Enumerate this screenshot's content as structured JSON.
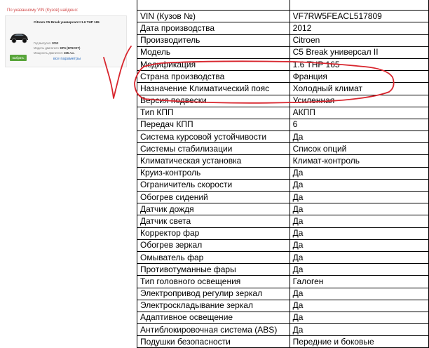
{
  "vin_panel": {
    "found_text": "По указанному VIN (Кузов) найдено:",
    "car_title": "Citroen C5 Break универсал II 1.6 THP 165",
    "specs": [
      {
        "label": "Год выпуска:",
        "value": "2012"
      },
      {
        "label": "Модель двигателя:",
        "value": "EP6 (EP6CDT)"
      },
      {
        "label": "Мощность двигателя:",
        "value": "155 л.с."
      }
    ],
    "select_button": "выбрать",
    "all_params_link": "все параметры"
  },
  "table": {
    "rows": [
      {
        "name": "",
        "value": ""
      },
      {
        "name": "VIN (Кузов №)",
        "value": "VF7RW5FEACL517809"
      },
      {
        "name": "Дата производства",
        "value": "2012"
      },
      {
        "name": "Производитель",
        "value": "Citroen"
      },
      {
        "name": "Модель",
        "value": "C5 Break универсал II"
      },
      {
        "name": "Модификация",
        "value": "1.6 THP 165"
      },
      {
        "name": "Страна производства",
        "value": "Франция"
      },
      {
        "name": "Назначение Климатический пояс",
        "value": "Холодный климат"
      },
      {
        "name": "Версия подвески",
        "value": "Усиленная"
      },
      {
        "name": "Тип КПП",
        "value": "АКПП"
      },
      {
        "name": "Передач КПП",
        "value": "6"
      },
      {
        "name": "Система курсовой устойчивости",
        "value": "Да"
      },
      {
        "name": "Системы стабилизации",
        "value": "Список опций"
      },
      {
        "name": "Климатическая установка",
        "value": "Климат-контроль"
      },
      {
        "name": "Круиз-контроль",
        "value": "Да"
      },
      {
        "name": "Ограничитель скорости",
        "value": "Да"
      },
      {
        "name": "Обогрев сидений",
        "value": "Да"
      },
      {
        "name": "Датчик дождя",
        "value": "Да"
      },
      {
        "name": "Датчик света",
        "value": "Да"
      },
      {
        "name": "Корректор фар",
        "value": "Да"
      },
      {
        "name": "Обогрев зеркал",
        "value": "Да"
      },
      {
        "name": "Омыватель фар",
        "value": "Да"
      },
      {
        "name": "Противотуманные фары",
        "value": "Да"
      },
      {
        "name": "Тип головного освещения",
        "value": "Галоген"
      },
      {
        "name": "Электропривод регулир зеркал",
        "value": "Да"
      },
      {
        "name": "Электроскладывание зеркал",
        "value": "Да"
      },
      {
        "name": "Адаптивное освещение",
        "value": "Да"
      },
      {
        "name": "Антиблокировочная система (ABS)",
        "value": "Да"
      },
      {
        "name": "Подушки безопасности",
        "value": "Передние и боковые"
      }
    ]
  },
  "annotations": {
    "ink_color": "#d8262e",
    "marks": [
      "handwritten-oval",
      "handwritten-checkmark"
    ]
  }
}
